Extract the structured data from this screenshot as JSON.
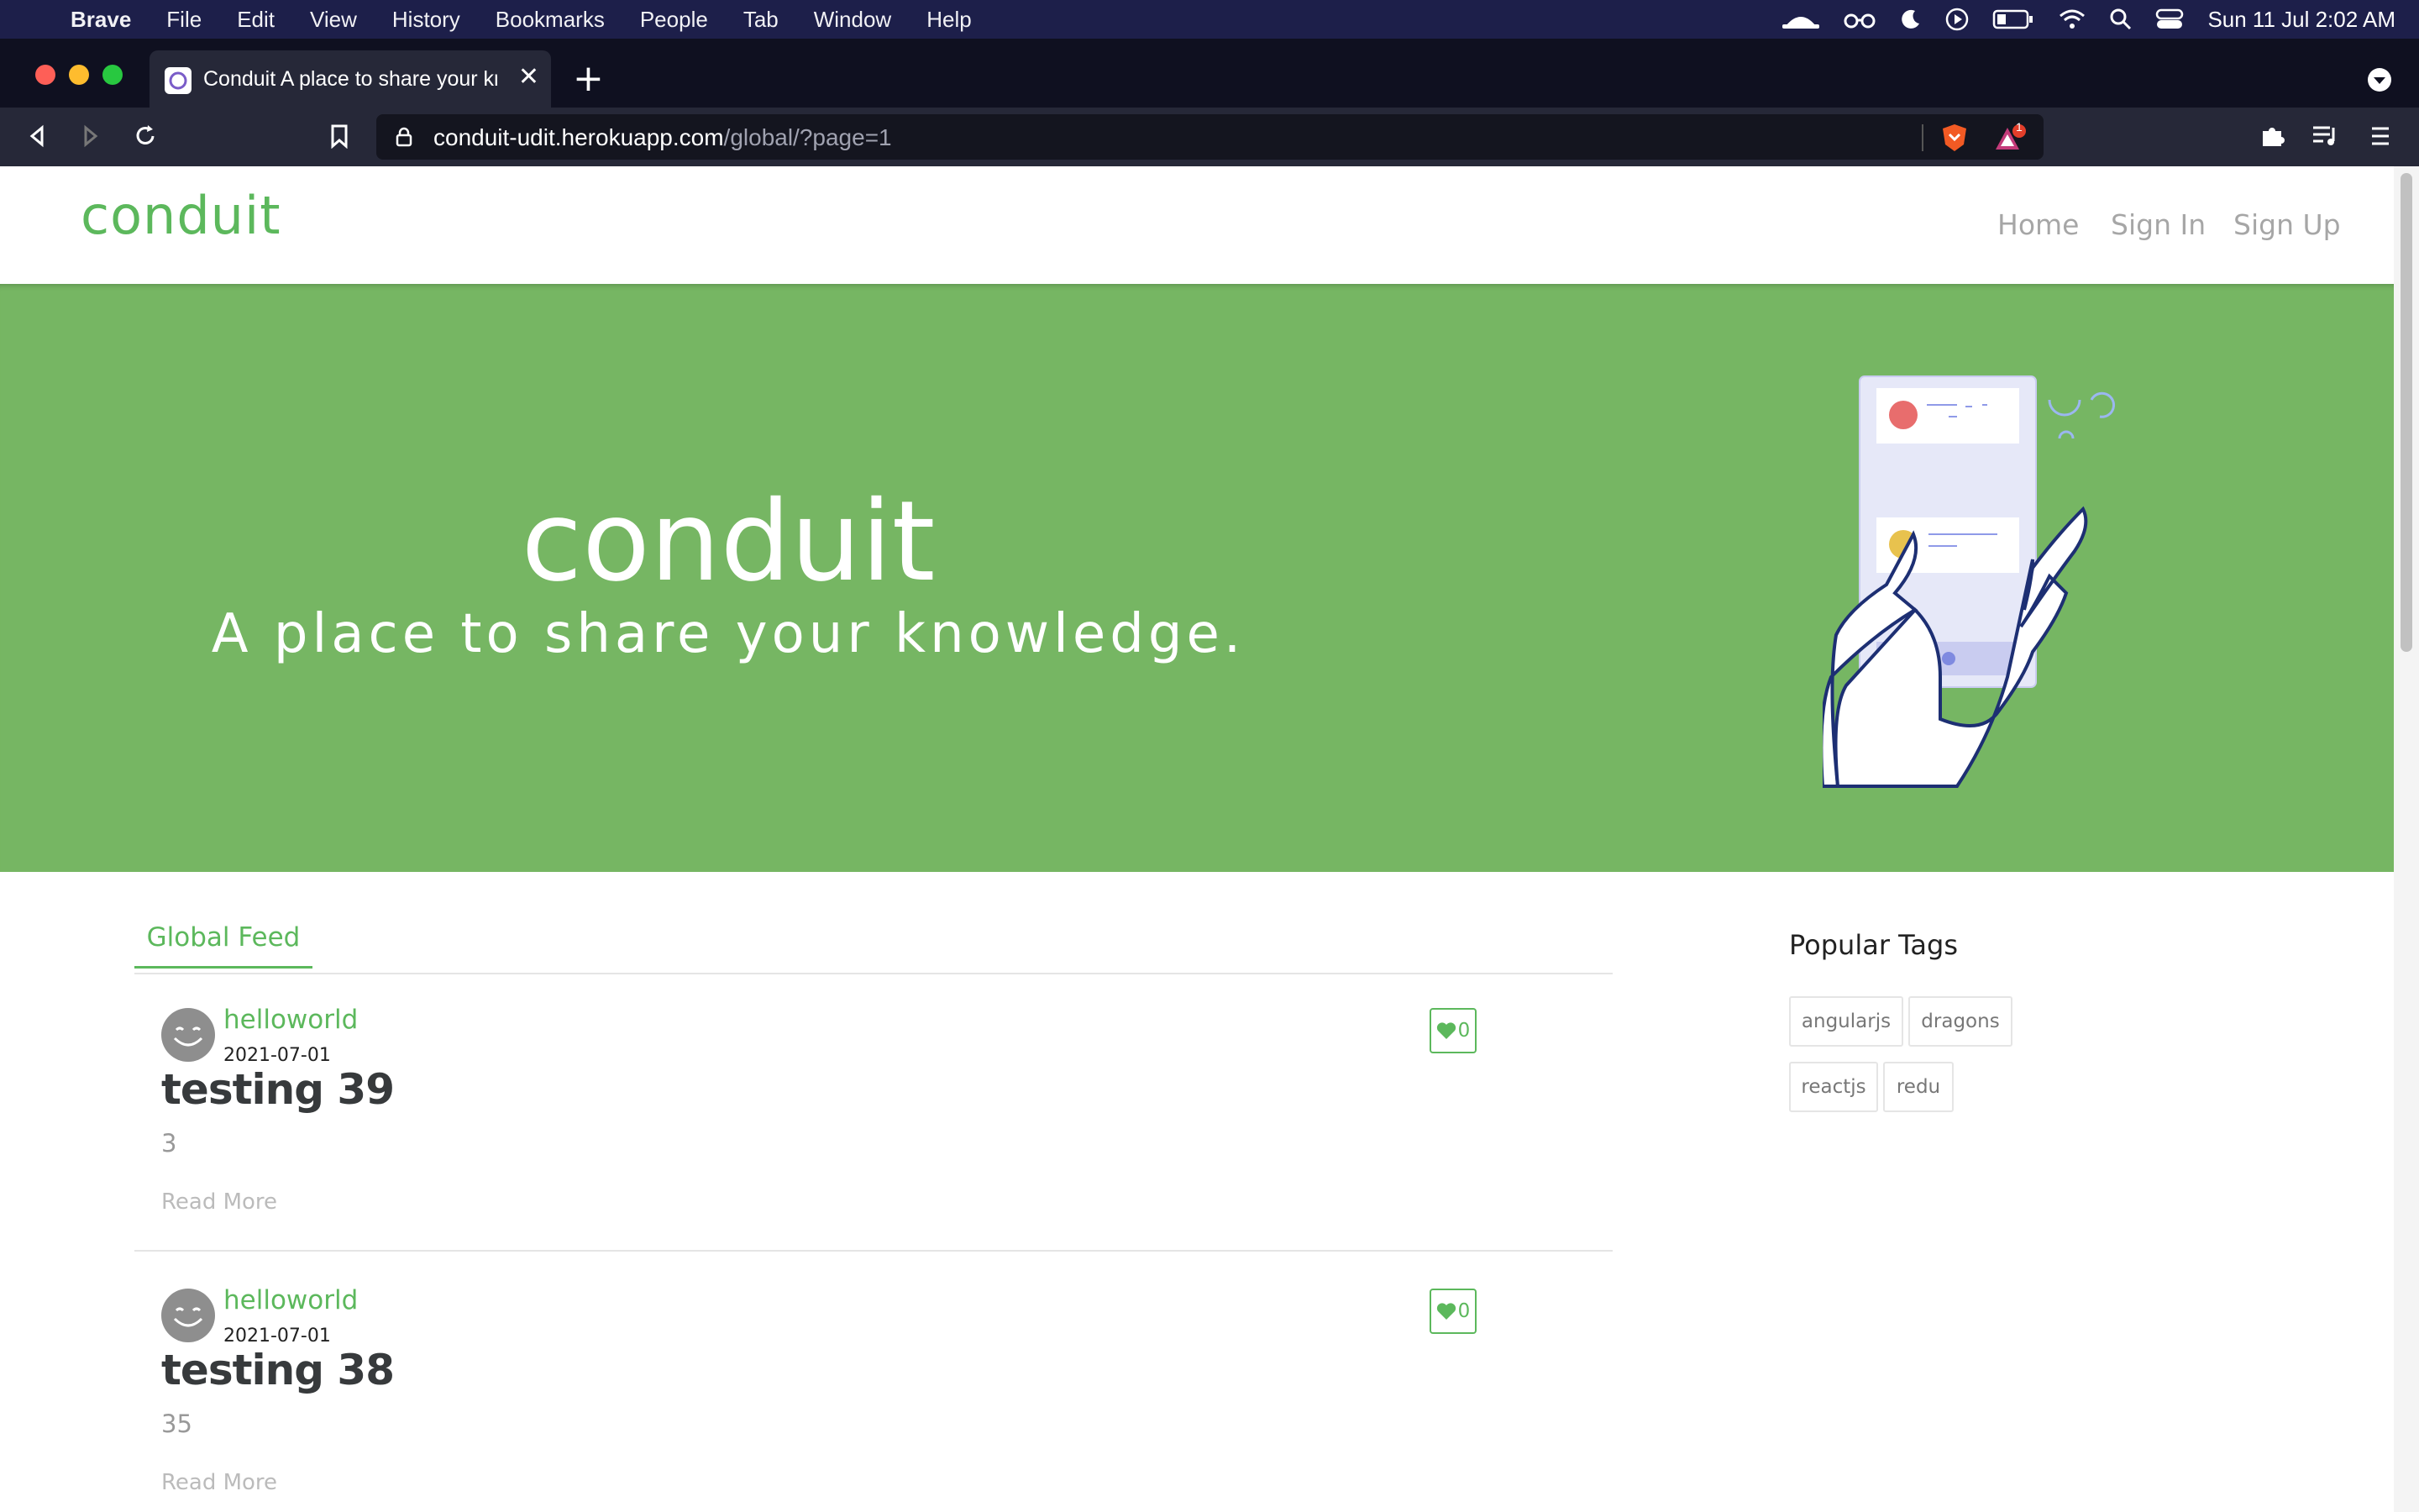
{
  "menubar": {
    "apple": "",
    "items": [
      "Brave",
      "File",
      "Edit",
      "View",
      "History",
      "Bookmarks",
      "People",
      "Tab",
      "Window",
      "Help"
    ],
    "clock": "Sun 11 Jul  2:02 AM"
  },
  "browser": {
    "tab_title": "Conduit A place to share your knowledge",
    "new_tab": "+",
    "url_host": "conduit-udit.herokuapp.com",
    "url_path": "/global/?page=1",
    "rewards_badge": "1"
  },
  "nav": {
    "brand": "conduit",
    "links": [
      "Home",
      "Sign In",
      "Sign Up"
    ]
  },
  "banner": {
    "title": "conduit",
    "subtitle": "A place to share your knowledge."
  },
  "feed": {
    "tab": "Global Feed",
    "articles": [
      {
        "author": "helloworld",
        "date": "2021-07-01",
        "title": "testing 39",
        "description": "3",
        "likes": "0",
        "read_more": "Read More"
      },
      {
        "author": "helloworld",
        "date": "2021-07-01",
        "title": "testing 38",
        "description": "35",
        "likes": "0",
        "read_more": "Read More"
      }
    ]
  },
  "sidebar": {
    "title": "Popular Tags",
    "tags": [
      "angularjs",
      "dragons",
      "reactjs",
      "redu"
    ]
  },
  "colors": {
    "brand_green": "#5cb85c",
    "banner_green": "#76b663",
    "menubar": "#1d1f4a"
  }
}
